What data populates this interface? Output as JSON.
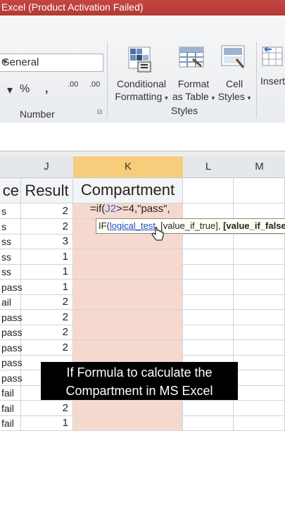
{
  "window": {
    "title": "Excel (Product Activation Failed)"
  },
  "ribbon": {
    "number_format": "General",
    "number_group_label": "Number",
    "percent": "%",
    "comma": ",",
    "inc_decimal": ".00",
    "dec_decimal": ".00",
    "conditional_formatting": [
      "Conditional",
      "Formatting"
    ],
    "format_as_table": [
      "Format",
      "as Table"
    ],
    "cell_styles": [
      "Cell",
      "Styles"
    ],
    "styles_group_label": "Styles",
    "insert": "Insert"
  },
  "columns": [
    "J",
    "K",
    "L",
    "M"
  ],
  "headers": {
    "col_i": "ce",
    "col_j": "Result",
    "col_k": "Compartment"
  },
  "formula": {
    "prefix": "=if(",
    "ref": "J2",
    "rest": ">=4,\"pass\","
  },
  "tooltip": {
    "fn": "IF(",
    "arg1": "logical_test",
    "arg2": ", [value_if_true], ",
    "arg3": "[value_if_false])"
  },
  "rows": [
    {
      "i": "s",
      "j": "2"
    },
    {
      "i": "s",
      "j": "2"
    },
    {
      "i": "ss",
      "j": "3"
    },
    {
      "i": "ss",
      "j": "1"
    },
    {
      "i": "ss",
      "j": "1"
    },
    {
      "i": "pass",
      "j": "1"
    },
    {
      "i": "ail",
      "j": "2"
    },
    {
      "i": "pass",
      "j": "2"
    },
    {
      "i": "pass",
      "j": "2"
    },
    {
      "i": "pass",
      "j": "2"
    },
    {
      "i": "pass",
      "j": ""
    },
    {
      "i": "pass",
      "j": ""
    },
    {
      "i": "fail",
      "j": ""
    },
    {
      "i": "fail",
      "j": "2"
    },
    {
      "i": "fail",
      "j": "1"
    }
  ],
  "caption": [
    "If Formula to calculate the",
    "Compartment in MS Excel"
  ]
}
